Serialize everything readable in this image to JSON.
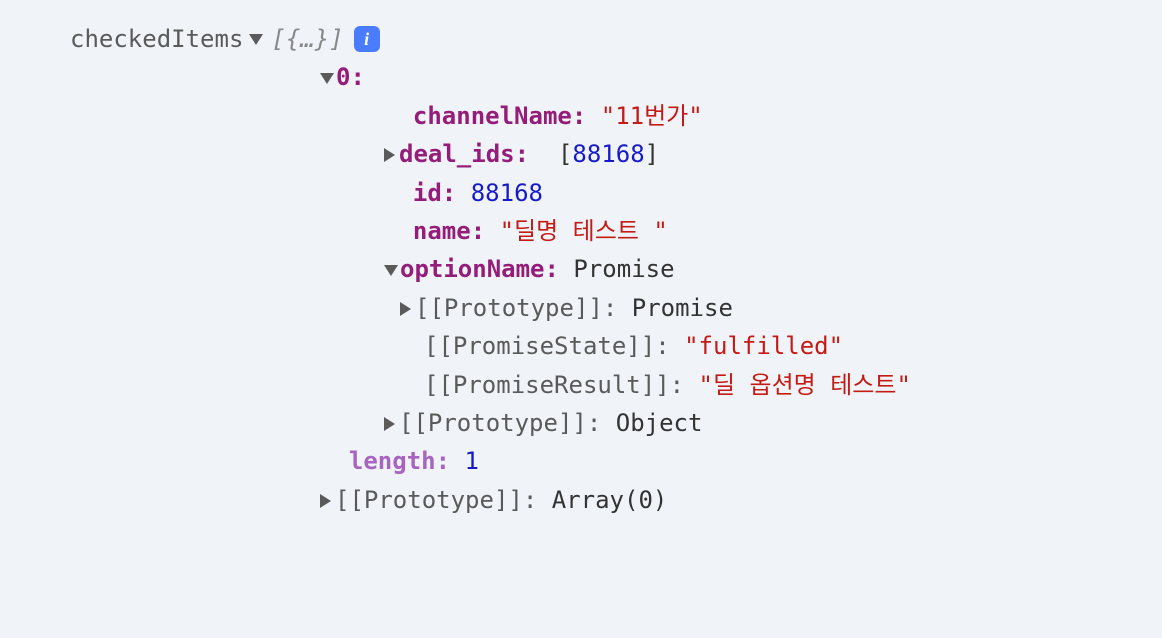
{
  "root": {
    "varName": "checkedItems",
    "summary": "[{…}]",
    "infoBadge": "i"
  },
  "item0": {
    "indexLabel": "0:",
    "channelName": {
      "key": "channelName:",
      "value": "\"11번가\""
    },
    "dealIds": {
      "key": "deal_ids:",
      "bracketOpen": "[",
      "value": "88168",
      "bracketClose": "]"
    },
    "id": {
      "key": "id:",
      "value": "88168"
    },
    "name": {
      "key": "name:",
      "value": "\"딜명 테스트 \""
    },
    "optionName": {
      "key": "optionName:",
      "value": "Promise",
      "prototype": {
        "key": "[[Prototype]]:",
        "value": "Promise"
      },
      "promiseState": {
        "key": "[[PromiseState]]:",
        "value": "\"fulfilled\""
      },
      "promiseResult": {
        "key": "[[PromiseResult]]:",
        "value": "\"딜 옵션명 테스트\""
      }
    },
    "prototype": {
      "key": "[[Prototype]]:",
      "value": "Object"
    }
  },
  "array": {
    "length": {
      "key": "length:",
      "value": "1"
    },
    "prototype": {
      "key": "[[Prototype]]:",
      "value": "Array(0)"
    }
  }
}
